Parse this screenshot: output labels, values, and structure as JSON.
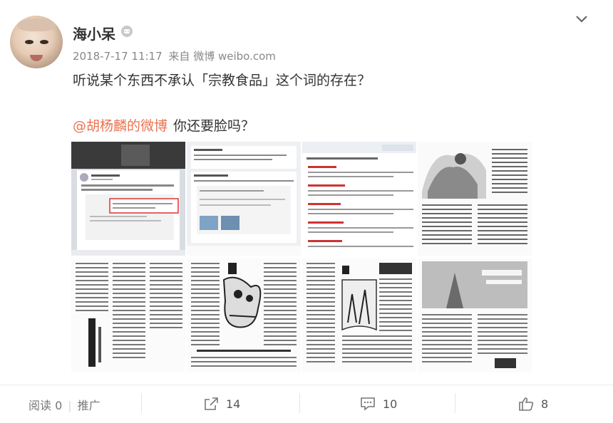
{
  "post": {
    "username": "海小呆",
    "date": "2018-7-17 11:17",
    "source_prefix": "来自",
    "source": "微博 weibo.com",
    "text_line1": "听说某个东西不承认「宗教食品」这个词的存在？",
    "mention": "@胡杨麟的微博",
    "text_line2": "你还要脸吗？"
  },
  "footer": {
    "reads": "阅读 0",
    "promote": "推广",
    "share_count": "14",
    "comment_count": "10",
    "like_count": "8"
  },
  "icons": [
    "avatar",
    "member-badge-icon",
    "chevron-down-icon",
    "share-icon",
    "comment-icon",
    "like-icon"
  ],
  "colors": {
    "mention": "#eb7350",
    "text": "#333333",
    "meta": "#888888"
  }
}
